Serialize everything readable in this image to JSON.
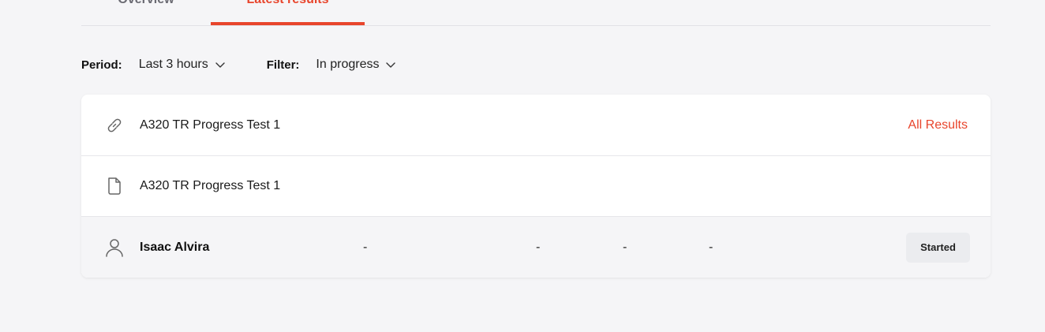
{
  "tabs": [
    {
      "label": "Overview",
      "active": false
    },
    {
      "label": "Latest results",
      "active": true
    }
  ],
  "filters": {
    "period_label": "Period:",
    "period_value": "Last 3 hours",
    "filter_label": "Filter:",
    "filter_value": "In progress"
  },
  "card": {
    "link_row": {
      "icon": "link-icon",
      "title": "A320 TR Progress Test 1",
      "action_label": "All Results"
    },
    "document_row": {
      "icon": "document-icon",
      "title": "A320 TR Progress Test 1"
    },
    "user_row": {
      "icon": "user-icon",
      "name": "Isaac Alvira",
      "cells": [
        "-",
        "-",
        "-",
        "-"
      ],
      "status": "Started"
    }
  },
  "colors": {
    "accent": "#e8452c",
    "background": "#f5f5f7",
    "badge_bg": "#ebecef"
  }
}
